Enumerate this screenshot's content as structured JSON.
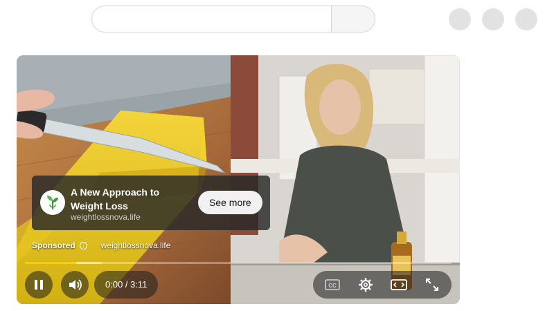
{
  "search": {
    "placeholder": ""
  },
  "ad": {
    "title": "A New Approach to Weight Loss",
    "domain": "weightlossnova.life",
    "cta_label": "See more",
    "sponsored_label": "Sponsored",
    "sponsored_domain": "weightlossnova.life"
  },
  "player": {
    "time_display": "0:00 / 3:11",
    "progress_fraction": 0.12,
    "buffered_fraction": 0.18,
    "accent_color": "#ffcc00"
  },
  "icons": [
    "search-icon",
    "pause-icon",
    "volume-icon",
    "cc-icon",
    "gear-icon",
    "theater-icon",
    "fullscreen-icon",
    "info-icon",
    "leaf-logo-icon"
  ]
}
